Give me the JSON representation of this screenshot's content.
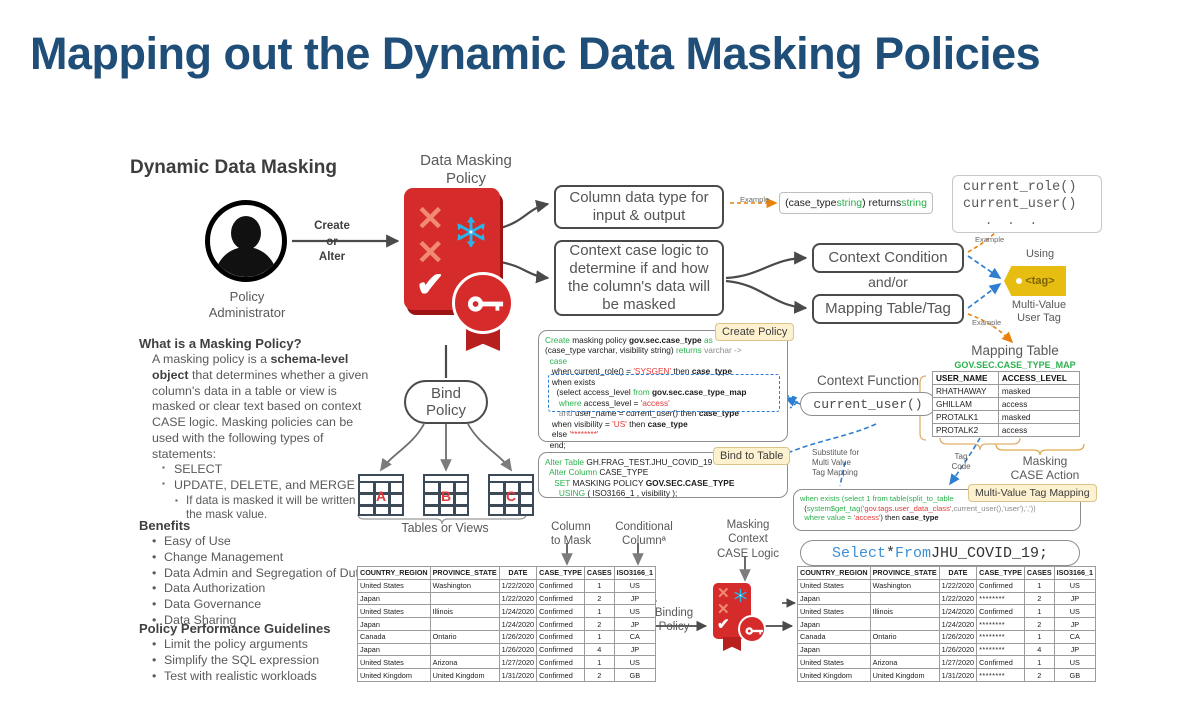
{
  "title": "Mapping out the Dynamic Data Masking Policies",
  "left": {
    "heading": "Dynamic Data Masking",
    "persona_label": "Policy\nAdministrator",
    "arrow_label": "Create\nor\nAlter",
    "what_is_title": "What is a Masking Policy?",
    "what_is_body_1": "A masking policy is a ",
    "what_is_bold": "schema-level object",
    "what_is_body_2": " that determines whether a given column's data in a table or view is masked or clear text based on context CASE logic. Masking policies can be used with the following types of statements:",
    "statement_types": [
      "SELECT",
      "UPDATE, DELETE, and MERGE"
    ],
    "statement_note": "If data is masked it will be written as the mask value.",
    "benefits_title": "Benefits",
    "benefits": [
      "Easy of Use",
      "Change Management",
      "Data Admin and Segregation of Duties",
      "Data Authorization",
      "Data Governance",
      "Data Sharing"
    ],
    "guidelines_title": "Policy Performance Guidelines",
    "guidelines": [
      "Limit the policy arguments",
      "Simplify the SQL expression",
      "Test with realistic workloads"
    ]
  },
  "policy_card": {
    "label": "Data Masking\nPolicy",
    "color": "#d62b2b",
    "shadow": "#9c1414",
    "snowflake_color": "#29b5e8"
  },
  "flow": {
    "column_data_type": "Column data type for\ninput & output",
    "context_case_logic": "Context case logic to\ndetermine if and how\nthe column's data will\nbe masked",
    "context_condition": "Context Condition",
    "and_or": "and/or",
    "mapping_table_tag": "Mapping Table/Tag",
    "example_label": "Example",
    "return_signature_prefix": "(case_type ",
    "return_signature_type1": "string",
    "return_signature_mid": ") returns ",
    "return_signature_type2": "string",
    "current_functions_line1": "current_role()",
    "current_functions_line2": "current_user()",
    "current_functions_dots": ". . .",
    "using_label": "Using",
    "tag_text": "<tag>",
    "multi_value_user_tag": "Multi-Value\nUser Tag",
    "bind_policy": "Bind\nPolicy",
    "tables_views": "Tables or Views",
    "table_letters": [
      "A",
      "B",
      "C"
    ]
  },
  "code": {
    "create_callout": "Create Policy",
    "create_lines": [
      [
        [
          "Create ",
          "kw"
        ],
        [
          "masking policy ",
          "plain"
        ],
        [
          "gov.sec.case_type",
          "bld"
        ],
        [
          " as",
          "kw"
        ]
      ],
      [
        [
          "(case_type varchar, visibility string) ",
          "plain"
        ],
        [
          "returns",
          "kw"
        ],
        [
          " varchar ->",
          "gry"
        ]
      ],
      [
        [
          "  case",
          "kw"
        ]
      ],
      [
        [
          "   when",
          "plain"
        ],
        [
          " current_role() = ",
          "plain"
        ],
        [
          "'SYSGEN'",
          "str"
        ],
        [
          " then ",
          "plain"
        ],
        [
          "case_type",
          "bld"
        ]
      ],
      [
        [
          "   when exists",
          "plain"
        ]
      ],
      [
        [
          "     (select access_level ",
          "plain"
        ],
        [
          "from",
          "kw"
        ],
        [
          " gov.sec.case_type_map",
          "bld"
        ]
      ],
      [
        [
          "      where ",
          "kw"
        ],
        [
          "access_level = ",
          "plain"
        ],
        [
          "'access'",
          "str"
        ]
      ],
      [
        [
          "      and ",
          "gry"
        ],
        [
          "user_name = current_user()",
          "plain"
        ],
        [
          " then ",
          "plain"
        ],
        [
          "case_type",
          "bld"
        ]
      ],
      [
        [
          "   when ",
          "plain"
        ],
        [
          "visibility",
          "plain"
        ],
        [
          " = ",
          "plain"
        ],
        [
          "'US'",
          "str"
        ],
        [
          " then ",
          "plain"
        ],
        [
          "case_type",
          "bld"
        ]
      ],
      [
        [
          "   else ",
          "plain"
        ],
        [
          "'********'",
          "str"
        ]
      ],
      [
        [
          "  end;",
          "plain"
        ]
      ]
    ],
    "bind_callout": "Bind to Table",
    "bind_lines": [
      [
        [
          "Alter Table ",
          "kw"
        ],
        [
          "GH.FRAG_TEST.JHU_COVID_19",
          "plain"
        ]
      ],
      [
        [
          "  Alter Column ",
          "kw"
        ],
        [
          "CASE_TYPE",
          "plain"
        ]
      ],
      [
        [
          "    SET ",
          "kw"
        ],
        [
          "MASKING POLICY ",
          "plain"
        ],
        [
          "GOV.SEC.CASE_TYPE",
          "bld"
        ]
      ],
      [
        [
          "      USING ",
          "kw"
        ],
        [
          "( ISO3166_1 , visibility );",
          "plain"
        ]
      ]
    ],
    "tag_callout": "Multi-Value Tag Mapping",
    "tag_lines": [
      [
        [
          "when exists (select 1 from table(split_to_table",
          "kw"
        ]
      ],
      [
        [
          "  (",
          "plain"
        ],
        [
          "system$get_tag(",
          "kw"
        ],
        [
          "'gov.tags.user_data_class'",
          "str"
        ],
        [
          ",current_user(),'user'),',')) ",
          "gry"
        ]
      ],
      [
        [
          "  where value = ",
          "kw"
        ],
        [
          "'access'",
          "str"
        ],
        [
          ") then ",
          "plain"
        ],
        [
          "case_type",
          "bld"
        ]
      ]
    ],
    "select_query_kw1": "Select",
    "select_query_star": " * ",
    "select_query_kw2": "From",
    "select_query_obj": " JHU_COVID_19;"
  },
  "mapping_table": {
    "title": "Mapping Table",
    "subtitle": "GOV.SEC.CASE_TYPE_MAP",
    "headers": [
      "USER_NAME",
      "ACCESS_LEVEL"
    ],
    "rows": [
      [
        "RHATHAWAY",
        "masked"
      ],
      [
        "GHILLAM",
        "access"
      ],
      [
        "PROTALK1",
        "masked"
      ],
      [
        "PROTALK2",
        "access"
      ]
    ]
  },
  "context_function": {
    "title": "Context Function",
    "value": "current_user()"
  },
  "annotations": {
    "substitute": "Substitute for\nMulti Value\nTag Mapping",
    "tag_code": "Tag\nCode",
    "masking_case_action": "Masking\nCASE Action",
    "column_to_mask": "Column\nto Mask",
    "conditional_column": "Conditional\nColumnª",
    "masking_context": "Masking\nContext\nCASE Logic",
    "binding_policy": "Binding\nPolicy",
    "example": "Example"
  },
  "data_table": {
    "headers": [
      "COUNTRY_REGION",
      "PROVINCE_STATE",
      "DATE",
      "CASE_TYPE",
      "CASES",
      "ISO3166_1"
    ],
    "source_rows": [
      [
        "United States",
        "Washington",
        "1/22/2020",
        "Confirmed",
        "1",
        "US"
      ],
      [
        "Japan",
        "",
        "1/22/2020",
        "Confirmed",
        "2",
        "JP"
      ],
      [
        "United States",
        "Illinois",
        "1/24/2020",
        "Confirmed",
        "1",
        "US"
      ],
      [
        "Japan",
        "",
        "1/24/2020",
        "Confirmed",
        "2",
        "JP"
      ],
      [
        "Canada",
        "Ontario",
        "1/26/2020",
        "Confirmed",
        "1",
        "CA"
      ],
      [
        "Japan",
        "",
        "1/26/2020",
        "Confirmed",
        "4",
        "JP"
      ],
      [
        "United States",
        "Arizona",
        "1/27/2020",
        "Confirmed",
        "1",
        "US"
      ],
      [
        "United Kingdom",
        "United Kingdom",
        "1/31/2020",
        "Confirmed",
        "2",
        "GB"
      ]
    ],
    "output_rows": [
      [
        "United States",
        "Washington",
        "1/22/2020",
        "Confirmed",
        "1",
        "US"
      ],
      [
        "Japan",
        "",
        "1/22/2020",
        "********",
        "2",
        "JP"
      ],
      [
        "United States",
        "Illinois",
        "1/24/2020",
        "Confirmed",
        "1",
        "US"
      ],
      [
        "Japan",
        "",
        "1/24/2020",
        "********",
        "2",
        "JP"
      ],
      [
        "Canada",
        "Ontario",
        "1/26/2020",
        "********",
        "1",
        "CA"
      ],
      [
        "Japan",
        "",
        "1/26/2020",
        "********",
        "4",
        "JP"
      ],
      [
        "United States",
        "Arizona",
        "1/27/2020",
        "Confirmed",
        "1",
        "US"
      ],
      [
        "United Kingdom",
        "United Kingdom",
        "1/31/2020",
        "********",
        "2",
        "GB"
      ]
    ]
  },
  "colors": {
    "title_blue": "#1F4E79",
    "policy_red": "#d62b2b",
    "snowflake_blue": "#29b5e8",
    "tag_yellow": "#e8bd12",
    "keyword_green": "#2bb24c",
    "string_red": "#e23a3a",
    "dashed_blue": "#2f7fd1",
    "dashed_orange": "#e8820c"
  }
}
